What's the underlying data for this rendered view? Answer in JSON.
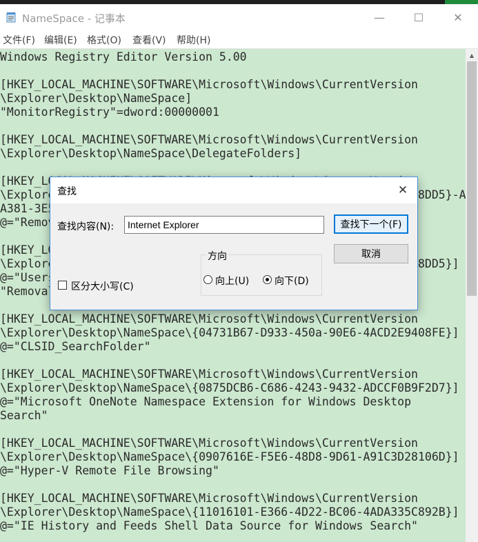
{
  "window": {
    "title": "NameSpace - 记事本",
    "minimize": "—",
    "maximize": "☐",
    "close": "✕"
  },
  "menu": [
    {
      "label": "文件(F)"
    },
    {
      "label": "编辑(E)"
    },
    {
      "label": "格式(O)"
    },
    {
      "label": "查看(V)"
    },
    {
      "label": "帮助(H)"
    }
  ],
  "editor": {
    "lines": [
      "Windows Registry Editor Version 5.00",
      "",
      "[HKEY_LOCAL_MACHINE\\SOFTWARE\\Microsoft\\Windows\\CurrentVersion",
      "\\Explorer\\Desktop\\NameSpace]",
      "\"MonitorRegistry\"=dword:00000001",
      "",
      "[HKEY_LOCAL_MACHINE\\SOFTWARE\\Microsoft\\Windows\\CurrentVersion",
      "\\Explorer\\Desktop\\NameSpace\\DelegateFolders]",
      "",
      "[HKEY_LOCAL_MACHINE\\SOFTWARE\\Microsoft\\Windows\\CurrentVersion",
      "\\Explorer\\Desktop\\NameSpace\\{031E4825-7B94-4dc3-B131-E946B44C8DD5}-A16-",
      "A381-3E5",
      "@=\"Remov",
      "",
      "[HKEY_LOCAL_MACHINE\\SOFTWARE\\Microsoft\\Windows\\CurrentVersion",
      "\\Explorer\\Desktop\\NameSpace\\{031E4825-7B94-4dc3-B131-E946B44C8DD5}]",
      "@=\"Users",
      "\"Removal",
      "",
      "[HKEY_LOCAL_MACHINE\\SOFTWARE\\Microsoft\\Windows\\CurrentVersion",
      "\\Explorer\\Desktop\\NameSpace\\{04731B67-D933-450a-90E6-4ACD2E9408FE}]",
      "@=\"CLSID_SearchFolder\"",
      "",
      "[HKEY_LOCAL_MACHINE\\SOFTWARE\\Microsoft\\Windows\\CurrentVersion",
      "\\Explorer\\Desktop\\NameSpace\\{0875DCB6-C686-4243-9432-ADCCF0B9F2D7}]",
      "@=\"Microsoft OneNote Namespace Extension for Windows Desktop",
      "Search\"",
      "",
      "[HKEY_LOCAL_MACHINE\\SOFTWARE\\Microsoft\\Windows\\CurrentVersion",
      "\\Explorer\\Desktop\\NameSpace\\{0907616E-F5E6-48D8-9D61-A91C3D28106D}]",
      "@=\"Hyper-V Remote File Browsing\"",
      "",
      "[HKEY_LOCAL_MACHINE\\SOFTWARE\\Microsoft\\Windows\\CurrentVersion",
      "\\Explorer\\Desktop\\NameSpace\\{11016101-E366-4D22-BC06-4ADA335C892B}]",
      "@=\"IE History and Feeds Shell Data Source for Windows Search\""
    ]
  },
  "find_dialog": {
    "title": "查找",
    "close": "✕",
    "find_label": "查找内容(N):",
    "find_value": "Internet Explorer",
    "find_next_label": "查找下一个(F)",
    "cancel_label": "取消",
    "direction_label": "方向",
    "up_label": "向上(U)",
    "down_label": "向下(D)",
    "match_case_label": "区分大小写(C)",
    "direction_selected": "down",
    "match_case_checked": false
  },
  "colors": {
    "editor_bg": "#cce8cf",
    "accent": "#0078d7"
  }
}
